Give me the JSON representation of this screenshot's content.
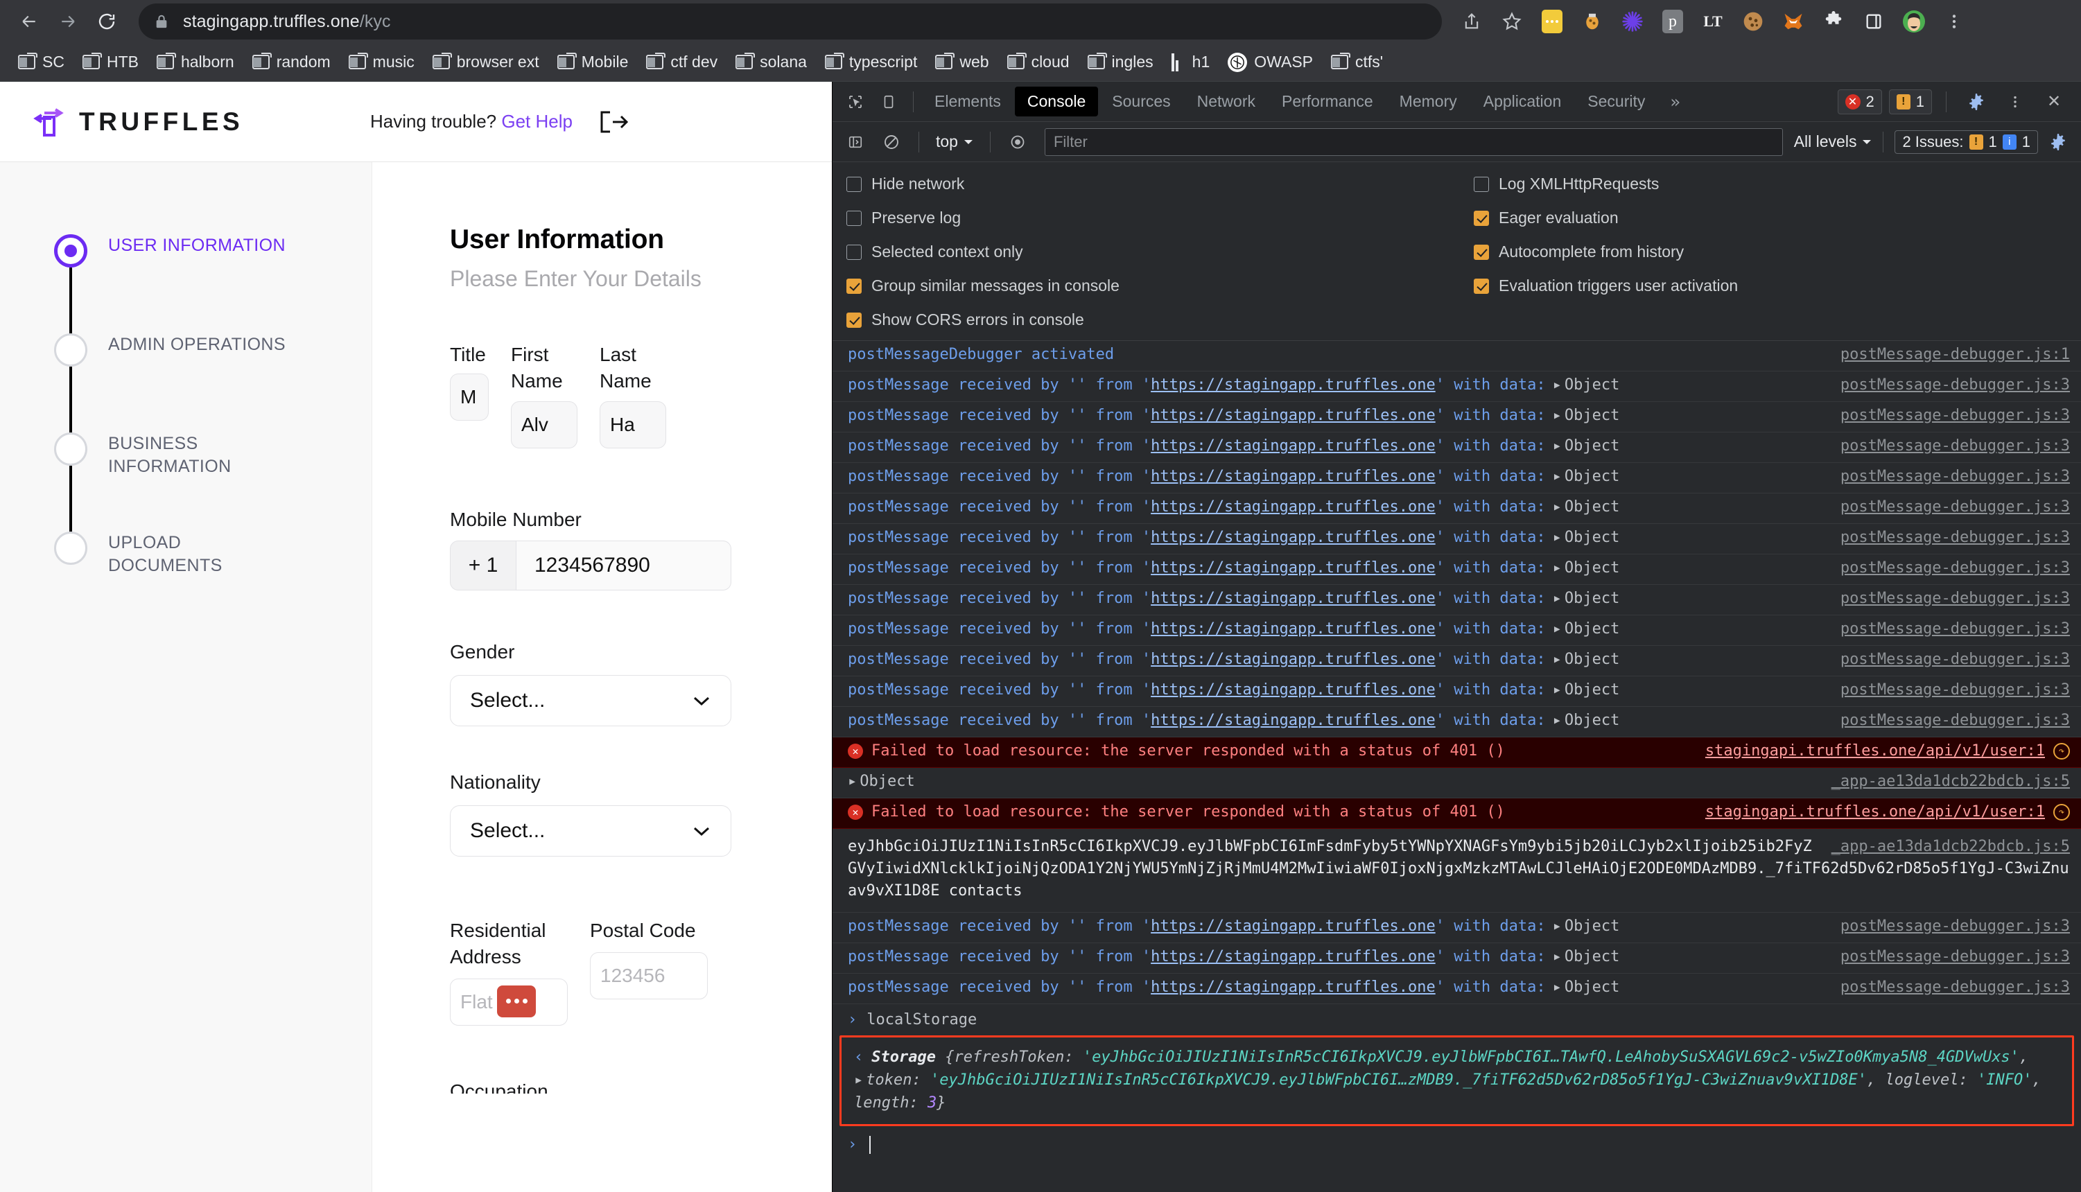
{
  "browser": {
    "url_host": "stagingapp.truffles.one",
    "url_path": "/kyc",
    "nav": {
      "back": "back-arrow",
      "forward": "forward-arrow",
      "reload": "reload"
    },
    "bookmarks": [
      {
        "label": "SC",
        "icon": "folder"
      },
      {
        "label": "HTB",
        "icon": "folder"
      },
      {
        "label": "halborn",
        "icon": "folder"
      },
      {
        "label": "random",
        "icon": "folder"
      },
      {
        "label": "music",
        "icon": "folder"
      },
      {
        "label": "browser ext",
        "icon": "folder"
      },
      {
        "label": "Mobile",
        "icon": "folder"
      },
      {
        "label": "ctf dev",
        "icon": "folder"
      },
      {
        "label": "solana",
        "icon": "folder"
      },
      {
        "label": "typescript",
        "icon": "folder"
      },
      {
        "label": "web",
        "icon": "folder"
      },
      {
        "label": "cloud",
        "icon": "folder"
      },
      {
        "label": "ingles",
        "icon": "folder"
      },
      {
        "label": "h1",
        "icon": "h1-logo"
      },
      {
        "label": "OWASP",
        "icon": "owasp-logo"
      },
      {
        "label": "ctfs'",
        "icon": "folder"
      }
    ]
  },
  "app": {
    "brand": "TRUFFLES",
    "help_prefix": "Having trouble?",
    "help_link": "Get Help",
    "logout_icon": "logout-icon",
    "steps": [
      {
        "label": "USER INFORMATION",
        "active": true
      },
      {
        "label": "ADMIN OPERATIONS",
        "active": false
      },
      {
        "label": "BUSINESS INFORMATION",
        "active": false
      },
      {
        "label": "UPLOAD DOCUMENTS",
        "active": false
      }
    ],
    "form": {
      "title": "User Information",
      "subtitle": "Please Enter Your Details",
      "title_label": "Title",
      "title_value": "M",
      "first_name_label": "First Name",
      "first_name_value": "Alv",
      "last_name_label": "Last Name",
      "last_name_value": "Ha",
      "mobile_label": "Mobile Number",
      "mobile_cc": "+ 1",
      "mobile_value": "1234567890",
      "gender_label": "Gender",
      "gender_value": "Select...",
      "nationality_label": "Nationality",
      "nationality_value": "Select...",
      "address_label": "Residential Address",
      "address_placeholder": "Flat N",
      "postal_label": "Postal Code",
      "postal_placeholder": "123456",
      "occupation_label": "Occupation"
    }
  },
  "devtools": {
    "tabs": [
      {
        "label": "Elements",
        "active": false
      },
      {
        "label": "Console",
        "active": true
      },
      {
        "label": "Sources",
        "active": false
      },
      {
        "label": "Network",
        "active": false
      },
      {
        "label": "Performance",
        "active": false
      },
      {
        "label": "Memory",
        "active": false
      },
      {
        "label": "Application",
        "active": false
      },
      {
        "label": "Security",
        "active": false
      }
    ],
    "more_tabs": "»",
    "error_count": "2",
    "warning_count": "1",
    "close_label": "✕",
    "console_bar": {
      "context": "top",
      "filter_placeholder": "Filter",
      "levels": "All levels",
      "issues_label": "2 Issues:",
      "issues_warning": "1",
      "issues_info": "1"
    },
    "settings_left": [
      {
        "label": "Hide network",
        "checked": false
      },
      {
        "label": "Preserve log",
        "checked": false
      },
      {
        "label": "Selected context only",
        "checked": false
      },
      {
        "label": "Group similar messages in console",
        "checked": true
      },
      {
        "label": "Show CORS errors in console",
        "checked": true
      }
    ],
    "settings_right": [
      {
        "label": "Log XMLHttpRequests",
        "checked": false
      },
      {
        "label": "Eager evaluation",
        "checked": true
      },
      {
        "label": "Autocomplete from history",
        "checked": true
      },
      {
        "label": "Evaluation triggers user activation",
        "checked": true
      }
    ],
    "log": {
      "activated_msg": "postMessageDebugger activated",
      "activated_src": "postMessage-debugger.js:1",
      "pm_prefix": "postMessage received by '' from '",
      "pm_origin": "https://stagingapp.truffles.one",
      "pm_suffix": "' with data:",
      "pm_object": "Object",
      "pm_src": "postMessage-debugger.js:3",
      "pm_count": 12,
      "error_msg": "Failed to load resource: the server responded with a status of 401 ()",
      "error_src": "stagingapi.truffles.one/api/v1/user:1",
      "object_label": "Object",
      "object_src": "_app-ae13da1dcb22bdcb.js:5",
      "jwt_src": "_app-ae13da1dcb22bdcb.js:5",
      "jwt_text": "eyJhbGciOiJIUzI1NiIsInR5cCI6IkpXVCJ9.eyJlbWFpbCI6ImFsdmFyby5tYWNpYXNAGFsYm9ybi5jb20iLCJyb2xlIjoib25ib2FyZGVyIiwidXNlcklkIjoiNjQzODA1Y2NjYWU5YmNjZjRjMmU4M2MwIiwiaWF0IjoxNjgxMzkzMTAwLCJleHAiOjE2ODE0MDAzMDB9._7fiTF62d5Dv62rD85o5f1YgJ-C3wiZnuav9vXI1D8E contacts",
      "eval_input": "localStorage",
      "eval_storage_label": "Storage",
      "eval_refresh_key": "refreshToken",
      "eval_refresh_value": "'eyJhbGciOiJIUzI1NiIsInR5cCI6IkpXVCJ9.eyJlbWFpbCI6I…TAwfQ.LeAhobySuSXAGVL69c2-v5wZIo0Kmya5N8_4GDVwUxs'",
      "eval_token_key": "token",
      "eval_token_value": "'eyJhbGciOiJIUzI1NiIsInR5cCI6IkpXVCJ9.eyJlbWFpbCI6I…zMDB9._7fiTF62d5Dv62rD85o5f1YgJ-C3wiZnuav9vXI1D8E'",
      "eval_loglevel_key": "loglevel",
      "eval_loglevel_value": "'INFO'",
      "eval_length_key": "length",
      "eval_length_value": "3",
      "highlight_color": "#ff3b1f"
    }
  }
}
